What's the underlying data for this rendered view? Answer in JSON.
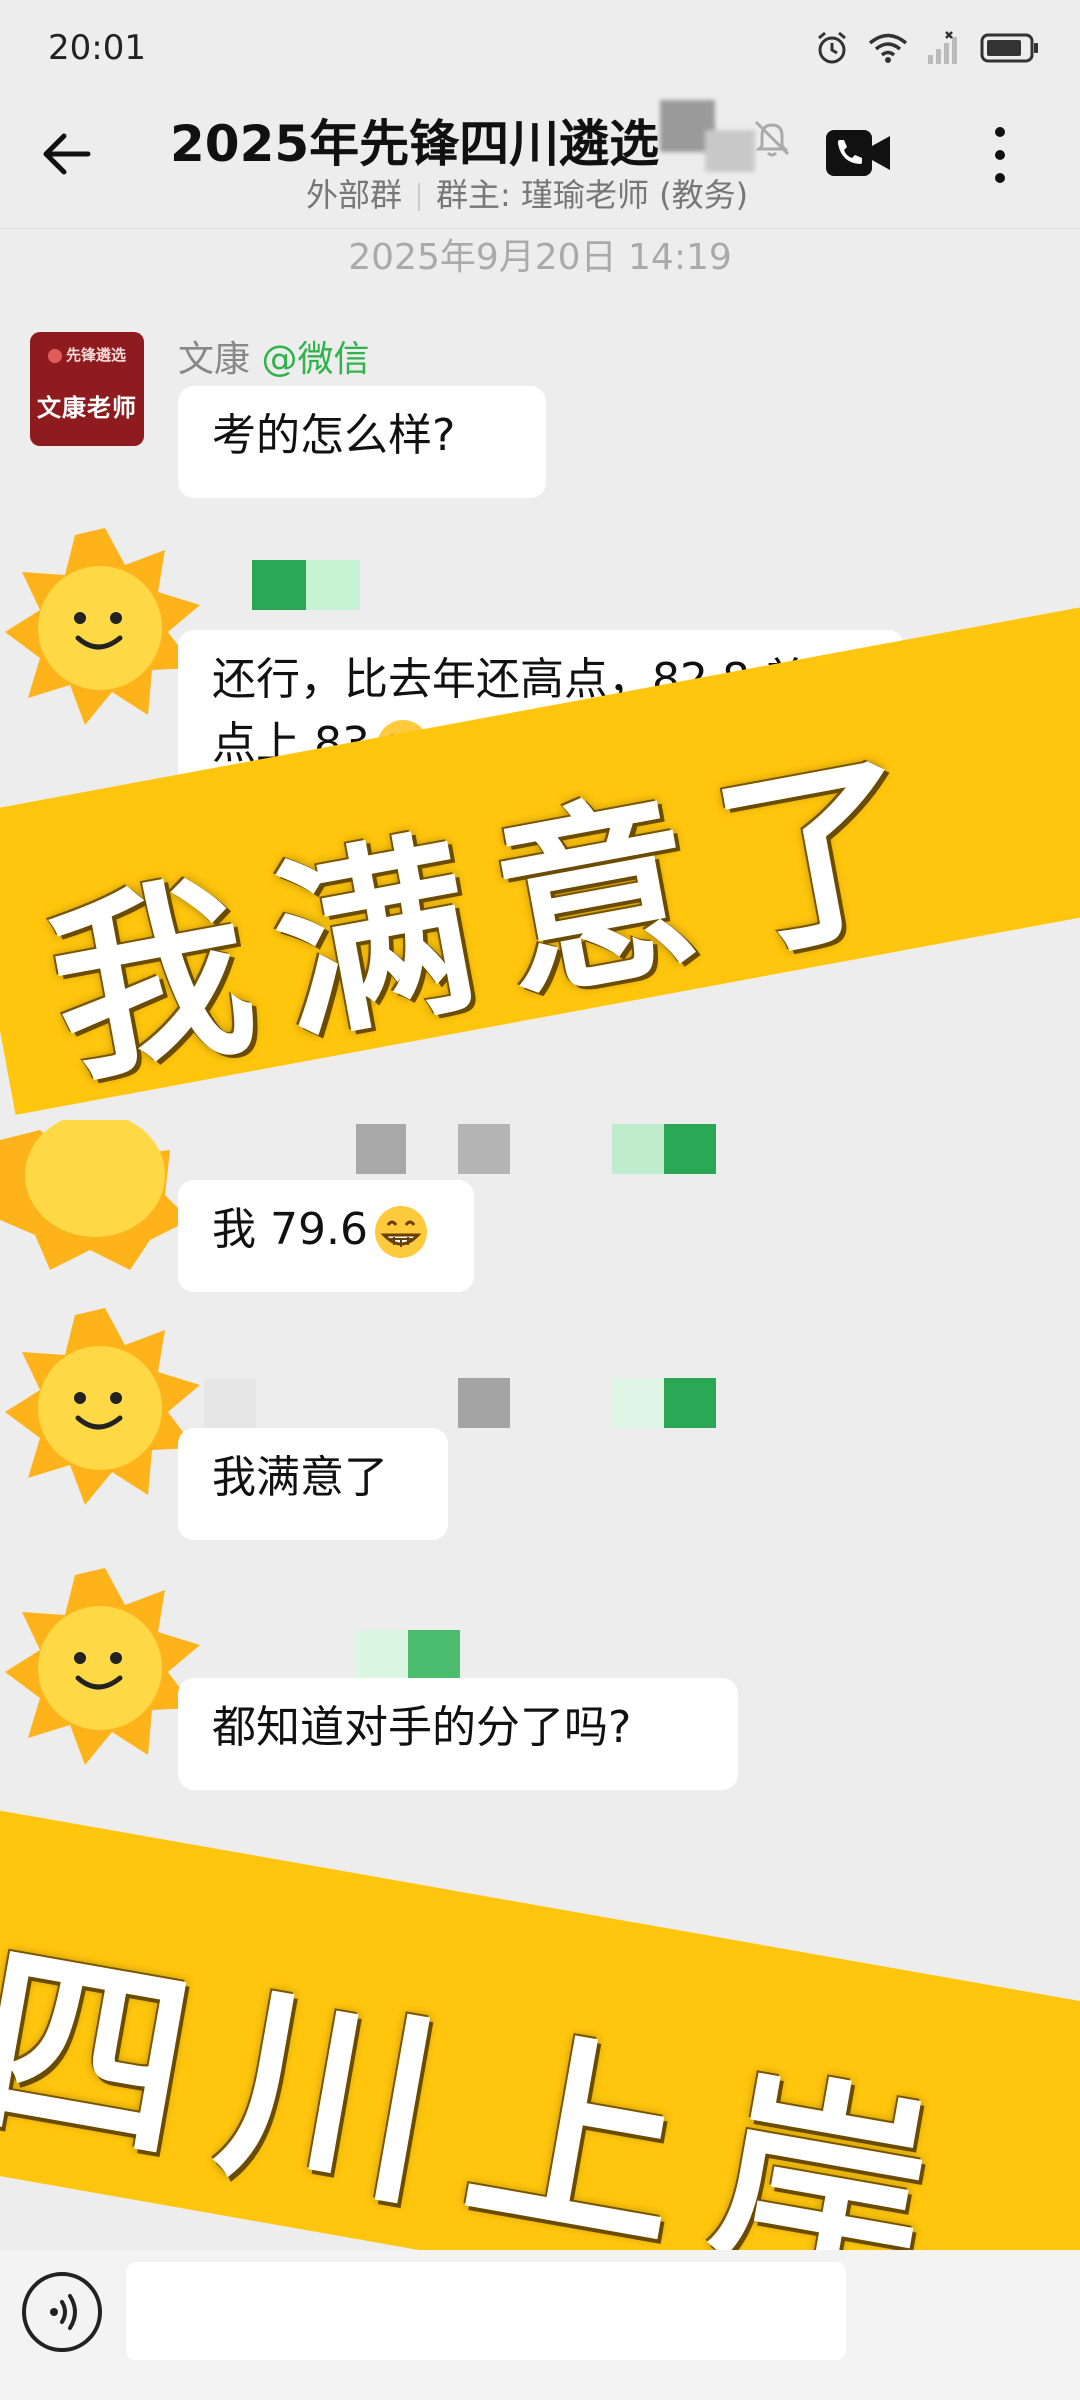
{
  "status_bar": {
    "time": "20:01"
  },
  "header": {
    "title": "2025年先锋四川遴选",
    "subtitle_type": "外部群",
    "subtitle_owner": "群主: 瑾瑜老师 (教务)"
  },
  "timestamp": "2025年9月20日  14:19",
  "avatar": {
    "logo_text": "先锋遴选",
    "name_text": "文康老师"
  },
  "messages": [
    {
      "sender": "文康",
      "sender_tag": "@微信",
      "text": "考的怎么样?"
    },
    {
      "text_line1": "还行，比去年还高点，82.8 差",
      "text_line2": "点上 83",
      "emoji": "tears-of-joy"
    },
    {
      "text": "我 79.6",
      "emoji": "grinning"
    },
    {
      "text": "我满意了"
    },
    {
      "text": "都知道对手的分了吗?"
    }
  ],
  "overlays": {
    "banner_top": "我满意了",
    "banner_bottom": "四川上岸"
  },
  "colors": {
    "banner": "#ffc60d",
    "sender_tag": "#2fb34a",
    "avatar_bg": "#8e1b1d"
  }
}
